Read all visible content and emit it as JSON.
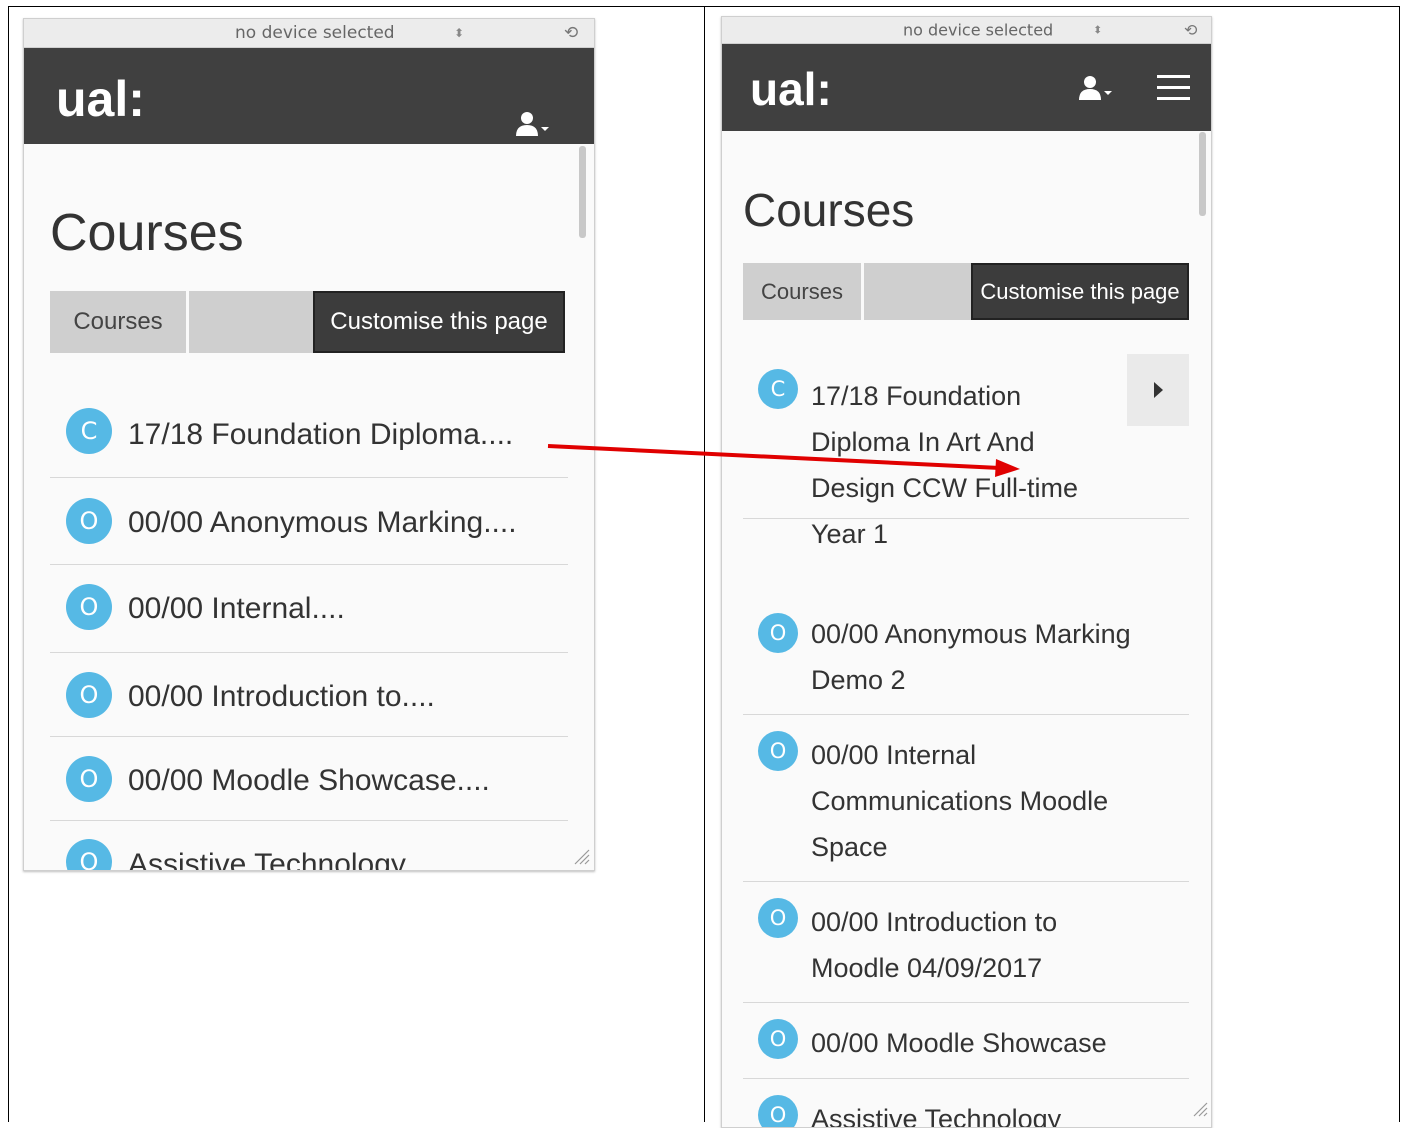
{
  "colors": {
    "navbar": "#404040",
    "badge": "#56b9e5",
    "active_tab": "#3c3c3c",
    "tab": "#cfcfcf",
    "annotation_arrow": "#e00000"
  },
  "left": {
    "device_bar": {
      "text": "no device selected",
      "stepper": "⬍",
      "rotate": "⟲"
    },
    "logo": "ual:",
    "heading": "Courses",
    "tabs": [
      {
        "label": "Courses"
      },
      {
        "label": ""
      },
      {
        "label": "Customise this page"
      }
    ],
    "courses": [
      {
        "badge": "C",
        "title": "17/18 Foundation Diploma...."
      },
      {
        "badge": "O",
        "title": "00/00 Anonymous Marking...."
      },
      {
        "badge": "O",
        "title": "00/00 Internal...."
      },
      {
        "badge": "O",
        "title": "00/00 Introduction to...."
      },
      {
        "badge": "O",
        "title": "00/00 Moodle Showcase...."
      },
      {
        "badge": "O",
        "title": "Assistive Technology"
      }
    ]
  },
  "right": {
    "device_bar": {
      "text": "no device selected",
      "stepper": "⬍",
      "rotate": "⟲"
    },
    "logo": "ual:",
    "heading": "Courses",
    "tabs": [
      {
        "label": "Courses"
      },
      {
        "label": ""
      },
      {
        "label": "Customise this page"
      }
    ],
    "courses": [
      {
        "badge": "C",
        "title": "17/18 Foundation Diploma In Art And Design CCW Full-time Year 1"
      },
      {
        "badge": "O",
        "title": "00/00 Anonymous Marking Demo 2"
      },
      {
        "badge": "O",
        "title": "00/00 Internal Communications Moodle Space"
      },
      {
        "badge": "O",
        "title": "00/00 Introduction to Moodle 04/09/2017"
      },
      {
        "badge": "O",
        "title": "00/00 Moodle Showcase"
      },
      {
        "badge": "O",
        "title": "Assistive Technology"
      }
    ]
  }
}
